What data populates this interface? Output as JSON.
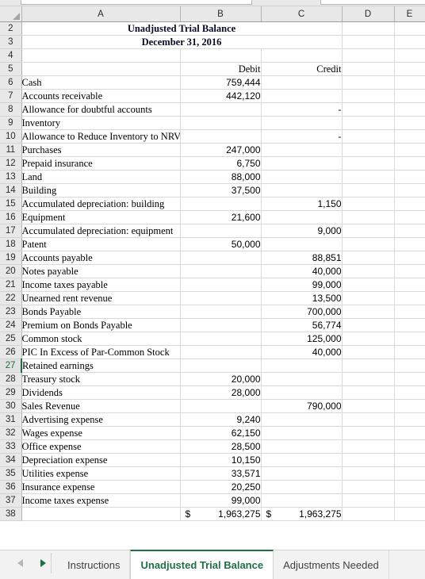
{
  "sheet": {
    "columns": [
      "A",
      "B",
      "C",
      "D",
      "E"
    ],
    "title_line1": "Unadjusted Trial Balance",
    "title_line2": "December 31, 2016",
    "debit_header": "Debit",
    "credit_header": "Credit",
    "active_row": "27",
    "currency_symbol": "$",
    "rows": [
      {
        "n": "2",
        "type": "title",
        "label": "Unadjusted Trial Balance"
      },
      {
        "n": "3",
        "type": "title",
        "label": "December 31, 2016"
      },
      {
        "n": "4",
        "type": "blank",
        "label": "",
        "debit": "",
        "credit": ""
      },
      {
        "n": "5",
        "type": "header",
        "label": "",
        "debit": "Debit",
        "credit": "Credit"
      },
      {
        "n": "6",
        "type": "data",
        "label": "Cash",
        "debit": "759,444",
        "credit": ""
      },
      {
        "n": "7",
        "type": "data",
        "label": "Accounts receivable",
        "debit": "442,120",
        "credit": ""
      },
      {
        "n": "8",
        "type": "data",
        "label": "Allowance for doubtful accounts",
        "debit": "",
        "credit": "-"
      },
      {
        "n": "9",
        "type": "data",
        "label": "Inventory",
        "debit": "",
        "credit": ""
      },
      {
        "n": "10",
        "type": "data",
        "label": "Allowance to Reduce Inventory to NRV",
        "debit": "",
        "credit": "-"
      },
      {
        "n": "11",
        "type": "data",
        "label": "Purchases",
        "debit": "247,000",
        "credit": ""
      },
      {
        "n": "12",
        "type": "data",
        "label": "Prepaid insurance",
        "debit": "6,750",
        "credit": ""
      },
      {
        "n": "13",
        "type": "data",
        "label": "Land",
        "debit": "88,000",
        "credit": ""
      },
      {
        "n": "14",
        "type": "data",
        "label": "Building",
        "debit": "37,500",
        "credit": ""
      },
      {
        "n": "15",
        "type": "data",
        "label": "Accumulated depreciation: building",
        "debit": "",
        "credit": "1,150"
      },
      {
        "n": "16",
        "type": "data",
        "label": "Equipment",
        "debit": "21,600",
        "credit": ""
      },
      {
        "n": "17",
        "type": "data",
        "label": "Accumulated depreciation: equipment",
        "debit": "",
        "credit": "9,000"
      },
      {
        "n": "18",
        "type": "data",
        "label": "Patent",
        "debit": "50,000",
        "credit": ""
      },
      {
        "n": "19",
        "type": "data",
        "label": "Accounts payable",
        "debit": "",
        "credit": "88,851"
      },
      {
        "n": "20",
        "type": "data",
        "label": "Notes payable",
        "debit": "",
        "credit": "40,000"
      },
      {
        "n": "21",
        "type": "data",
        "label": "Income taxes payable",
        "debit": "",
        "credit": "99,000"
      },
      {
        "n": "22",
        "type": "data",
        "label": "Unearned rent revenue",
        "debit": "",
        "credit": "13,500"
      },
      {
        "n": "23",
        "type": "data",
        "label": "Bonds Payable",
        "debit": "",
        "credit": "700,000"
      },
      {
        "n": "24",
        "type": "data",
        "label": "Premium on Bonds Payable",
        "debit": "",
        "credit": "56,774"
      },
      {
        "n": "25",
        "type": "data",
        "label": "Common stock",
        "debit": "",
        "credit": "125,000"
      },
      {
        "n": "26",
        "type": "data",
        "label": "PIC In Excess of Par-Common Stock",
        "debit": "",
        "credit": "40,000"
      },
      {
        "n": "27",
        "type": "data",
        "label": "Retained earnings",
        "debit": "",
        "credit": ""
      },
      {
        "n": "28",
        "type": "data",
        "label": "Treasury stock",
        "debit": "20,000",
        "credit": ""
      },
      {
        "n": "29",
        "type": "data",
        "label": "Dividends",
        "debit": "28,000",
        "credit": ""
      },
      {
        "n": "30",
        "type": "data",
        "label": "Sales Revenue",
        "debit": "",
        "credit": "790,000"
      },
      {
        "n": "31",
        "type": "data",
        "label": "Advertising expense",
        "debit": "9,240",
        "credit": ""
      },
      {
        "n": "32",
        "type": "data",
        "label": "Wages expense",
        "debit": "62,150",
        "credit": ""
      },
      {
        "n": "33",
        "type": "data",
        "label": "Office expense",
        "debit": "28,500",
        "credit": ""
      },
      {
        "n": "34",
        "type": "data",
        "label": "Depreciation expense",
        "debit": "10,150",
        "credit": ""
      },
      {
        "n": "35",
        "type": "data",
        "label": "Utilities expense",
        "debit": "33,571",
        "credit": ""
      },
      {
        "n": "36",
        "type": "data",
        "label": "Insurance expense",
        "debit": "20,250",
        "credit": ""
      },
      {
        "n": "37",
        "type": "data",
        "label": "Income taxes expense",
        "debit": "99,000",
        "credit": ""
      },
      {
        "n": "38",
        "type": "total",
        "label": "",
        "debit": "1,963,275",
        "credit": "1,963,275"
      }
    ]
  },
  "tabbar": {
    "prev_label": "previous-sheet",
    "next_label": "next-sheet",
    "tabs": [
      {
        "label": "Instructions",
        "active": false
      },
      {
        "label": "Unadjusted Trial Balance",
        "active": true
      },
      {
        "label": "Adjustments Needed",
        "active": false
      }
    ]
  },
  "colors": {
    "accent_green": "#1e7145",
    "header_gray": "#e8e8e8",
    "gridline": "#d9d9d9"
  }
}
